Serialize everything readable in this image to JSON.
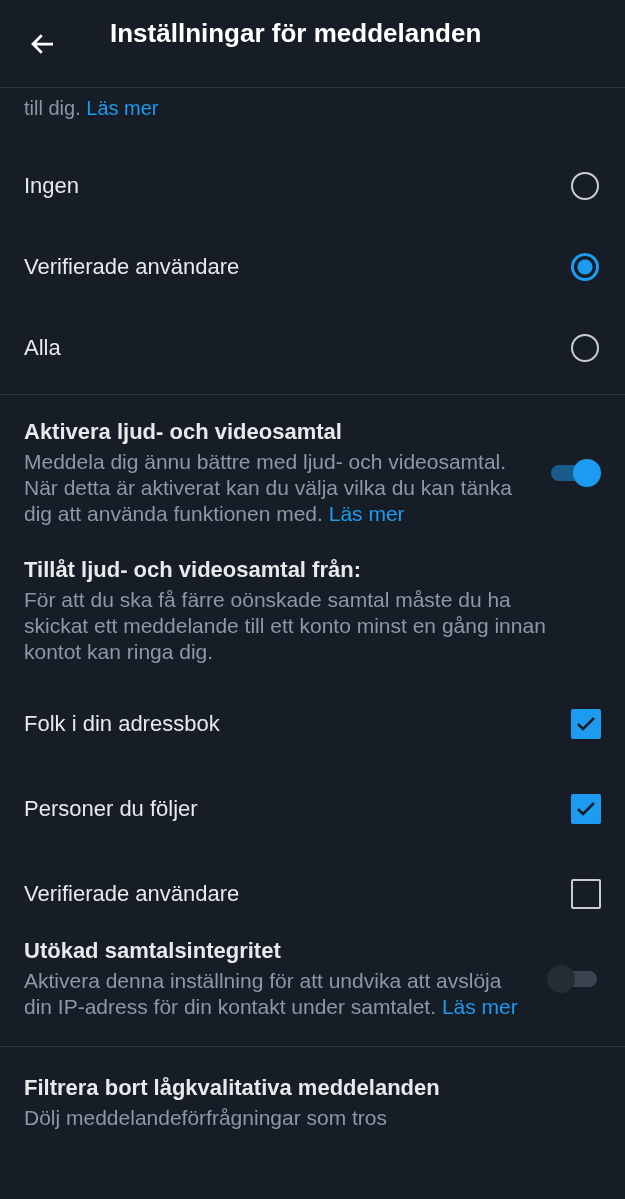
{
  "header": {
    "title": "Inställningar för meddelanden"
  },
  "intro": {
    "text": "till dig.",
    "link": "Läs mer"
  },
  "message_options": [
    {
      "label": "Ingen",
      "selected": false
    },
    {
      "label": "Verifierade användare",
      "selected": true
    },
    {
      "label": "Alla",
      "selected": false
    }
  ],
  "calls": {
    "title": "Aktivera ljud- och videosamtal",
    "description": "Meddela dig ännu bättre med ljud- och videosamtal. När detta är aktiverat kan du välja vilka du kan tänka dig att använda funktionen med.",
    "link": "Läs mer",
    "on": true
  },
  "calls_from": {
    "title": "Tillåt ljud- och videosamtal från:",
    "description": "För att du ska få färre oönskade samtal måste du ha skickat ett meddelande till ett konto minst en gång innan kontot kan ringa dig."
  },
  "call_options": [
    {
      "label": "Folk i din adressbok",
      "checked": true
    },
    {
      "label": "Personer du följer",
      "checked": true
    },
    {
      "label": "Verifierade användare",
      "checked": false
    }
  ],
  "privacy": {
    "title": "Utökad samtalsintegritet",
    "description": "Aktivera denna inställning för att undvika att avslöja din IP-adress för din kontakt under samtalet.",
    "link": "Läs mer",
    "on": false
  },
  "filter": {
    "title": "Filtrera bort lågkvalitativa meddelanden",
    "description": "Dölj meddelandeförfrågningar som tros"
  }
}
